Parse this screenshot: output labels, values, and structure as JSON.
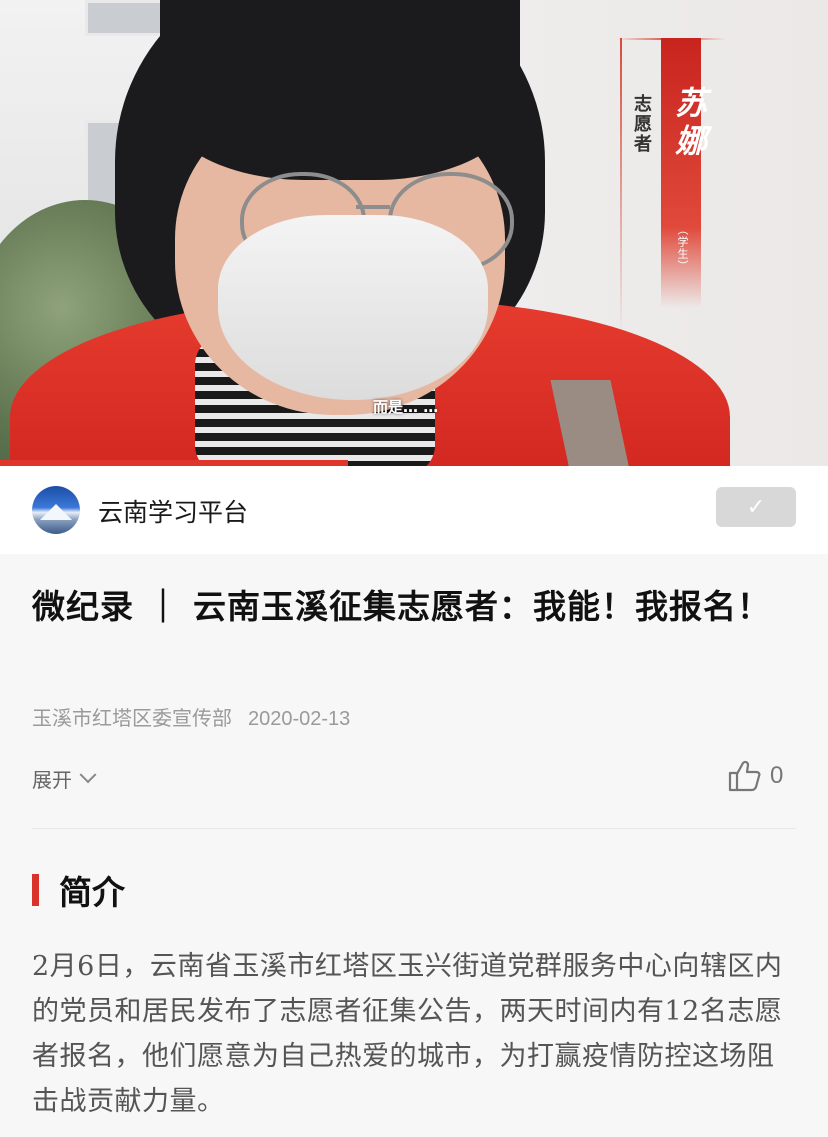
{
  "video": {
    "caption": "而是…  …",
    "name_tag": {
      "role": "志愿者",
      "name": "苏娜",
      "subtitle": "（学生）"
    },
    "progress_fraction": 0.42
  },
  "channel": {
    "name": "云南学习平台",
    "follow_icon": "check-icon"
  },
  "article": {
    "title": "微纪录 ｜ 云南玉溪征集志愿者：我能！我报名！",
    "source": "玉溪市红塔区委宣传部",
    "date": "2020-02-13",
    "expand_label": "展开",
    "like_count": "0"
  },
  "intro": {
    "heading": "简介",
    "body": "2月6日，云南省玉溪市红塔区玉兴街道党群服务中心向辖区内的党员和居民发布了志愿者征集公告，两天时间内有12名志愿者报名，他们愿意为自己热爱的城市，为打赢疫情防控这场阻击战贡献力量。"
  },
  "colors": {
    "accent_red": "#d8322a",
    "follow_button_bg": "#d8d8d8"
  }
}
